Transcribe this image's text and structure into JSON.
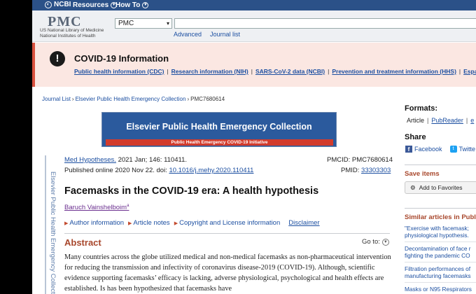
{
  "ncbi_bar": {
    "logo_text": "NCBI",
    "menus": [
      {
        "label": "Resources"
      },
      {
        "label": "How To"
      }
    ]
  },
  "header": {
    "logo": "PMC",
    "org_line1": "US National Library of Medicine",
    "org_line2": "National Institutes of Health",
    "db_select_value": "PMC",
    "advanced_link": "Advanced",
    "journal_list_link": "Journal list"
  },
  "covid_banner": {
    "title": "COVID-19 Information",
    "links": [
      "Public health information (CDC)",
      "Research information (NIH)",
      "SARS-CoV-2 data (NCBI)",
      "Prevention and treatment information (HHS)",
      "Españ"
    ]
  },
  "breadcrumb": [
    "Journal List",
    "Elsevier Public Health Emergency Collection",
    "PMC7680614"
  ],
  "collection_side_label": "Elsevier Public Health Emergency Collection",
  "collection_banner": {
    "title": "Elsevier Public Health Emergency Collection",
    "subtitle": "Public Health Emergency COVID-19 Initiative"
  },
  "citation": {
    "journal": "Med Hypotheses.",
    "date_vol": " 2021 Jan; 146: 110411.",
    "published_prefix": "Published online 2020 Nov 22. doi: ",
    "doi": "10.1016/j.mehy.2020.110411",
    "pmcid": "PMCID: PMC7680614",
    "pmid_label": "PMID: ",
    "pmid": "33303303"
  },
  "article": {
    "title": "Facemasks in the COVID-19 era: A health hypothesis",
    "author": "Baruch Vainshelboim",
    "author_mark": "a",
    "links": [
      "Author information",
      "Article notes",
      "Copyright and License information"
    ],
    "disclaimer": "Disclaimer"
  },
  "abstract": {
    "heading": "Abstract",
    "goto_label": "Go to:",
    "text": "Many countries across the globe utilized medical and non-medical facemasks as non-pharmaceutical intervention for reducing the transmission and infectivity of coronavirus disease-2019 (COVID-19). Although, scientific evidence supporting facemasks’ efficacy is lacking, adverse physiological, psychological and health effects are established. Is has been hypothesized that facemasks have"
  },
  "sidebar": {
    "formats_heading": "Formats:",
    "format_links": [
      "Article",
      "PubReader",
      "e"
    ],
    "share_heading": "Share",
    "share_facebook": "Facebook",
    "share_twitter": "Twitte",
    "save_heading": "Save items",
    "favorites_button": "Add to Favorites",
    "similar_heading": "Similar articles in Publ",
    "similar_items": [
      "\"Exercise with facemask; physiological hypothesis.",
      "Decontamination of face r fighting the pandemic CO",
      "Filtration performances of manufacturing facemasks",
      "Masks or N95 Respirators"
    ]
  },
  "colors": {
    "ncbi_blue": "#2b5188",
    "link_blue": "#1c4fa1",
    "accent_red": "#d9523f",
    "heading_rust": "#a8472c",
    "banner_blue": "#2b5a9d"
  }
}
